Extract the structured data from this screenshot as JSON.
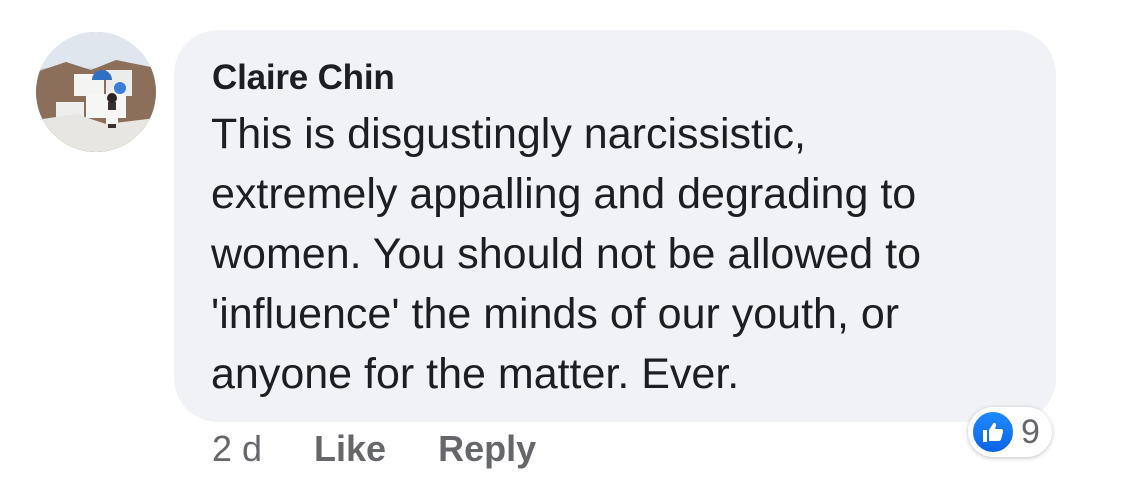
{
  "comment": {
    "author": "Claire Chin",
    "lines": [
      "This is disgustingly narcissistic,",
      "extremely appalling and degrading to",
      "women. You should not be allowed to",
      "'influence' the minds of our youth, or",
      "anyone for the matter. Ever."
    ],
    "timestamp": "2 d",
    "like_label": "Like",
    "reply_label": "Reply",
    "reaction_icon": "thumbs-up-icon",
    "reaction_count": "9"
  },
  "colors": {
    "bubble": "#f0f2f5",
    "text": "#1c1e21",
    "secondary_text": "#65676b",
    "like_blue": "#1877f2"
  }
}
